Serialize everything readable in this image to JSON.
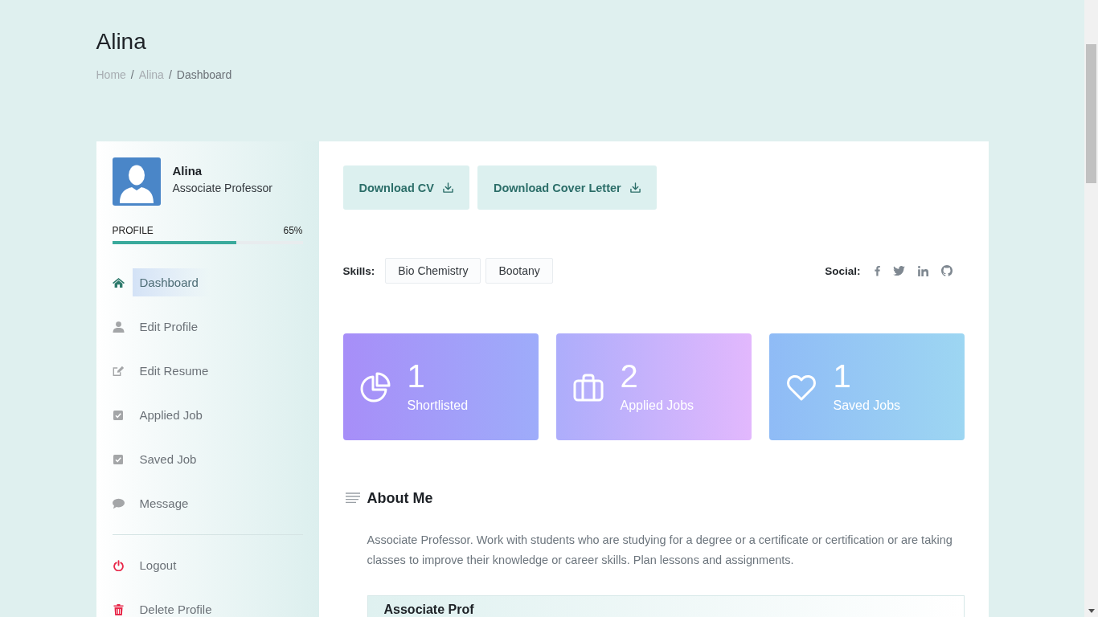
{
  "page_header": {
    "title": "Alina",
    "breadcrumb": [
      {
        "label": "Home",
        "separator": "/",
        "current": false
      },
      {
        "label": "Alina",
        "separator": "/",
        "current": false
      },
      {
        "label": "Dashboard",
        "current": true
      }
    ]
  },
  "sidebar": {
    "profile": {
      "name": "Alina",
      "role": "Associate Professor"
    },
    "completion": {
      "label": "PROFILE",
      "reading": "65%",
      "level": 0.65
    },
    "items": [
      {
        "label": "Dashboard",
        "selected": true
      },
      {
        "label": "Edit Profile",
        "selected": false
      },
      {
        "label": "Edit Resume",
        "selected": false
      },
      {
        "label": "Applied Job",
        "selected": false
      },
      {
        "label": "Saved Job",
        "selected": false
      },
      {
        "label": "Message",
        "selected": false
      }
    ],
    "account_items": [
      {
        "label": "Logout",
        "selected": false
      },
      {
        "label": "Delete Profile",
        "selected": false
      }
    ]
  },
  "actions": [
    {
      "label": "Download CV"
    },
    {
      "label": "Download Cover Letter"
    }
  ],
  "skills": {
    "label": "Skills:",
    "tags": [
      "Bio Chemistry",
      "Bootany"
    ]
  },
  "social": {
    "label": "Social:"
  },
  "stats": [
    {
      "value": "1",
      "label": "Shortlisted"
    },
    {
      "value": "2",
      "label": "Applied Jobs"
    },
    {
      "value": "1",
      "label": "Saved Jobs"
    }
  ],
  "about": {
    "title": "About Me",
    "text": "Associate Professor. Work with students who are studying for a degree or a certificate or certification or are taking classes to improve their knowledge or career skills. Plan lessons and assignments.",
    "card_title": "Associate Prof"
  }
}
